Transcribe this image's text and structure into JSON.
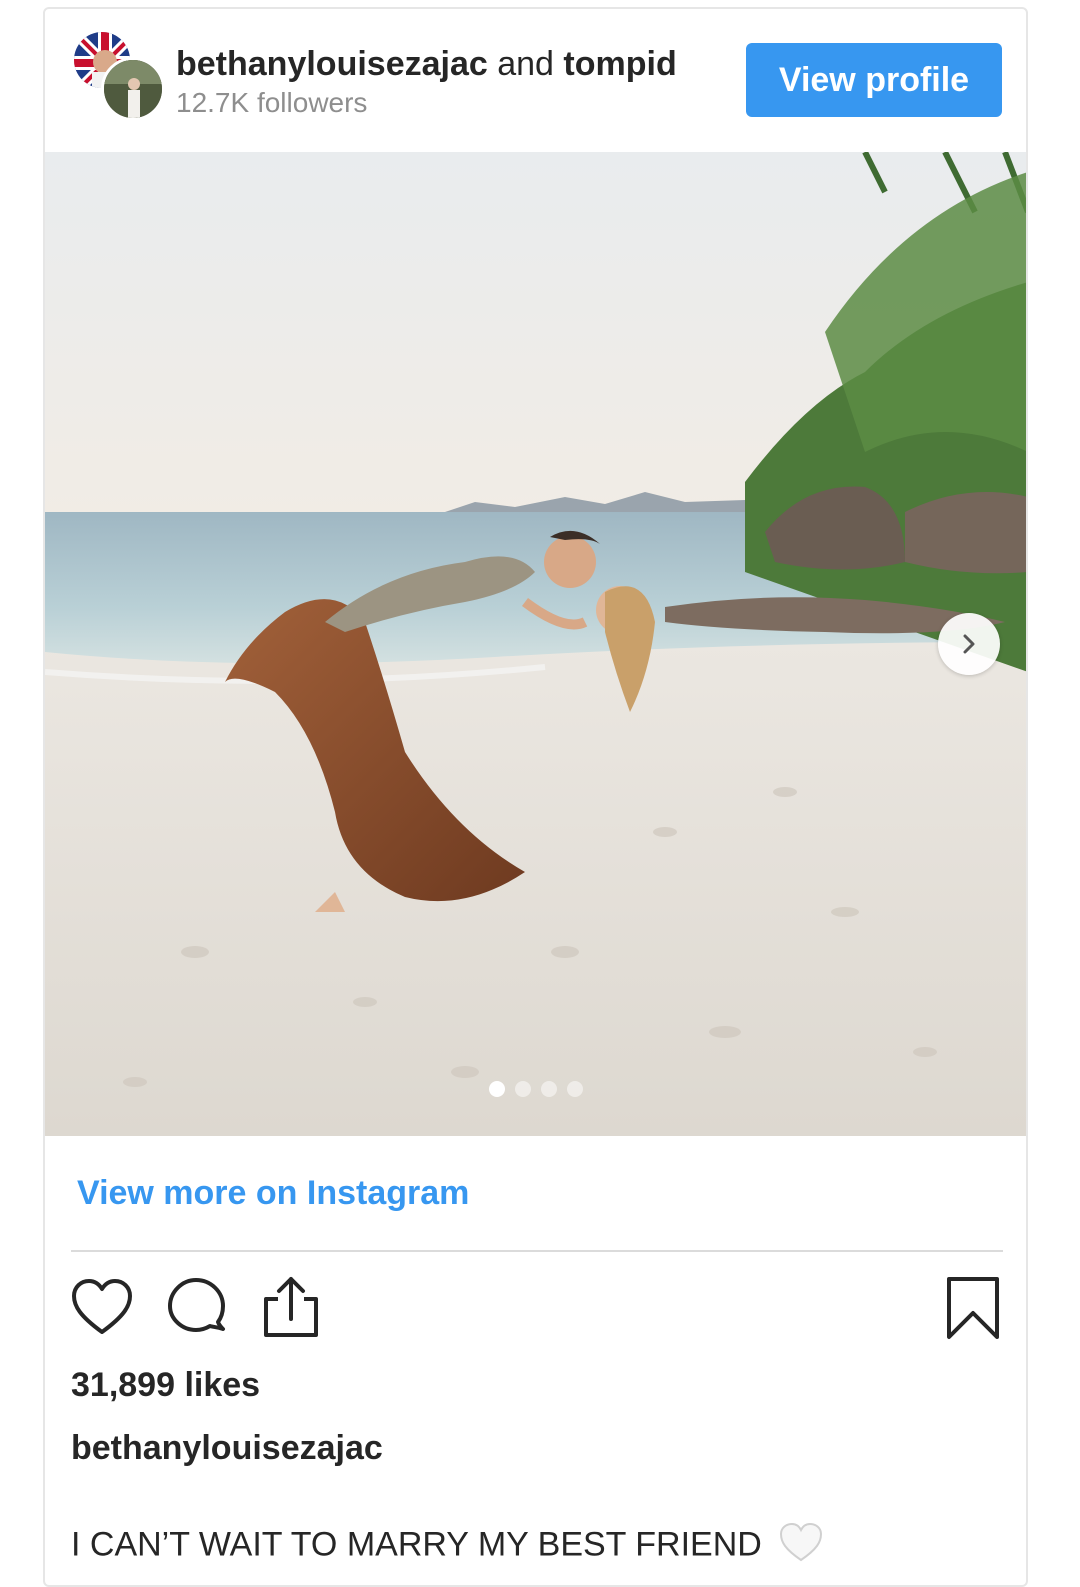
{
  "header": {
    "user1": "bethanylouisezajac",
    "conjunction": "and",
    "user2": "tompid",
    "followers": "12.7K followers",
    "view_profile_label": "View profile"
  },
  "carousel": {
    "total_slides": 4,
    "active_slide": 1
  },
  "view_more_label": "View more on Instagram",
  "actions": {
    "icons": [
      "heart-icon",
      "comment-icon",
      "share-icon",
      "bookmark-icon"
    ]
  },
  "likes": "31,899 likes",
  "caption": {
    "author": "bethanylouisezajac",
    "text": "I CAN’T WAIT TO MARRY MY BEST FRIEND"
  },
  "colors": {
    "accent": "#3797f0",
    "text": "#262626",
    "muted": "#8e8e8e"
  }
}
